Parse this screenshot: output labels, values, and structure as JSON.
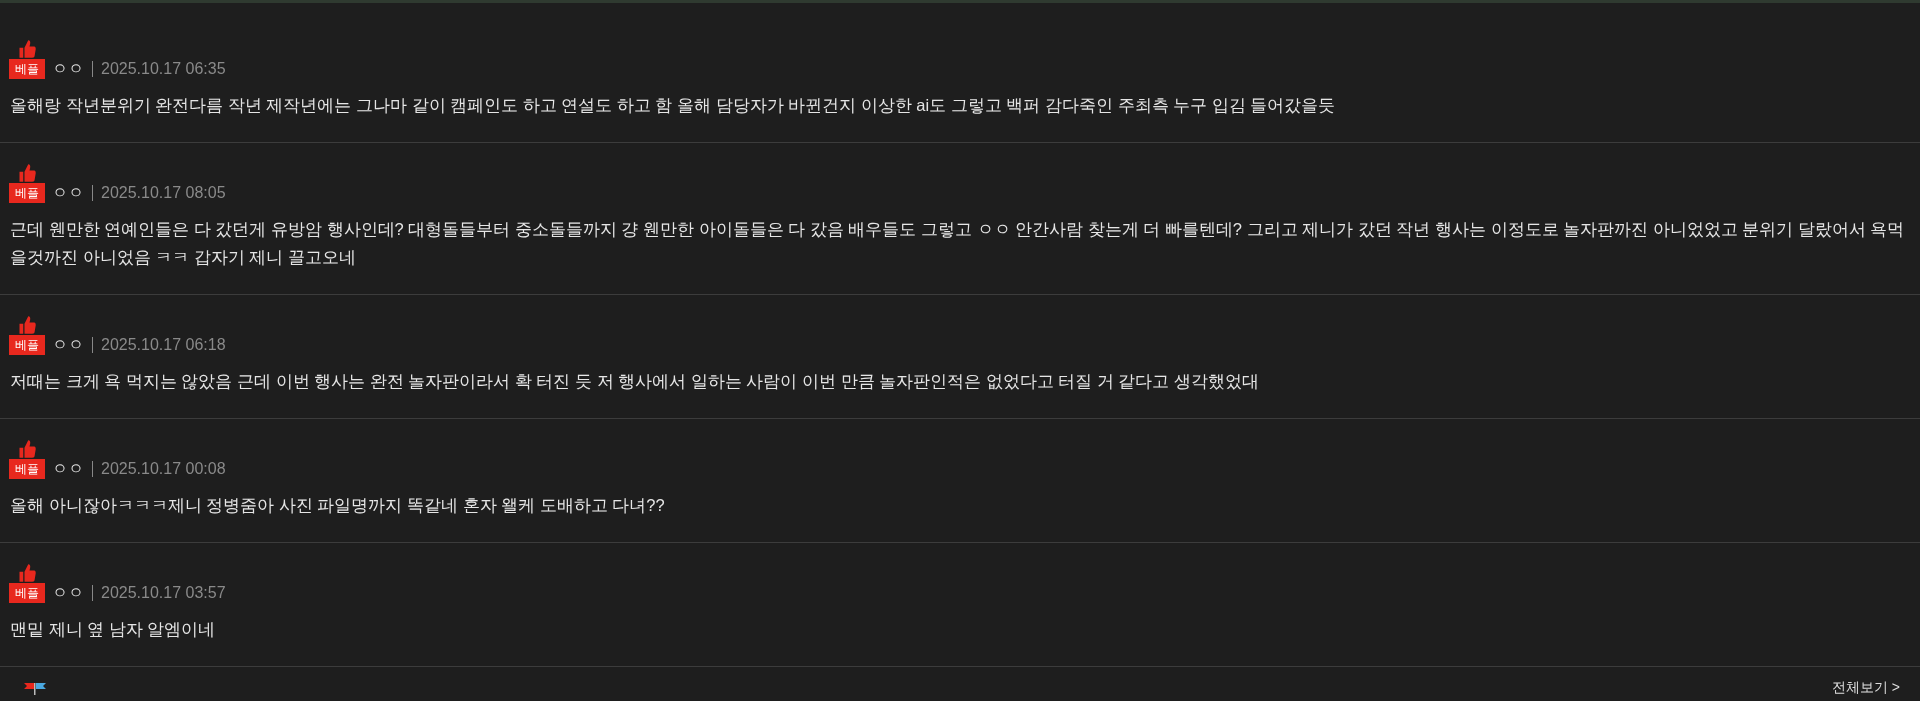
{
  "comments": [
    {
      "kind": "best",
      "badge": "베플",
      "author": "ㅇㅇ",
      "date": "2025.10.17 06:35",
      "text": "올해랑 작년분위기 완전다름 작년 제작년에는 그나마 같이 캠페인도 하고 연설도 하고 함 올해 담당자가 바뀐건지 이상한 ai도 그렇고 백퍼 감다죽인 주최측 누구 입김 들어갔을듯"
    },
    {
      "kind": "best",
      "badge": "베플",
      "author": "ㅇㅇ",
      "date": "2025.10.17 08:05",
      "text": "근데 웬만한 연예인들은 다 갔던게 유방암 행사인데? 대형돌들부터 중소돌들까지 걍 웬만한 아이돌들은 다 갔음 배우들도 그렇고 ㅇㅇ 안간사람 찾는게 더 빠를텐데? 그리고 제니가 갔던 작년 행사는 이정도로 놀자판까진 아니었었고 분위기 달랐어서 욕먹을것까진 아니었음 ㅋㅋ 갑자기 제니 끌고오네"
    },
    {
      "kind": "best",
      "badge": "베플",
      "author": "ㅇㅇ",
      "date": "2025.10.17 06:18",
      "text": "저때는 크게 욕 먹지는 않았음 근데 이번 행사는 완전 놀자판이라서 확 터진 듯 저 행사에서 일하는 사람이 이번 만큼 놀자판인적은 없었다고 터질 거 같다고 생각했었대"
    },
    {
      "kind": "best",
      "badge": "베플",
      "author": "ㅇㅇ",
      "date": "2025.10.17 00:08",
      "text": "올해 아니잖아ㅋㅋㅋ제니 정병줌아 사진 파일명까지 똑같네 혼자 왤케 도배하고 다녀??"
    },
    {
      "kind": "best",
      "badge": "베플",
      "author": "ㅇㅇ",
      "date": "2025.10.17 03:57",
      "text": "맨밑 제니 옆 남자 알엠이네"
    },
    {
      "kind": "flagged"
    }
  ],
  "view_all": "전체보기 >"
}
